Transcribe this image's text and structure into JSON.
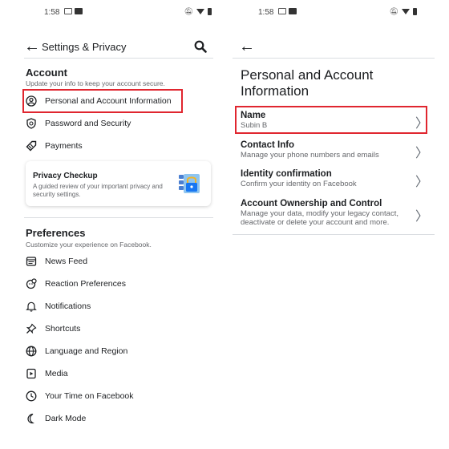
{
  "left": {
    "status_time": "1:58",
    "title": "Settings & Privacy",
    "account": {
      "title": "Account",
      "subtitle": "Update your info to keep your account secure.",
      "items": [
        {
          "label": "Personal and Account Information",
          "icon": "person-circle-icon"
        },
        {
          "label": "Password and Security",
          "icon": "shield-icon"
        },
        {
          "label": "Payments",
          "icon": "tag-icon"
        }
      ]
    },
    "privacy_checkup": {
      "title": "Privacy Checkup",
      "description": "A guided review of your important privacy and security settings.",
      "icon": "lock-checklist-icon"
    },
    "preferences": {
      "title": "Preferences",
      "subtitle": "Customize your experience on Facebook.",
      "items": [
        {
          "label": "News Feed",
          "icon": "news-feed-icon"
        },
        {
          "label": "Reaction Preferences",
          "icon": "reaction-icon"
        },
        {
          "label": "Notifications",
          "icon": "bell-icon"
        },
        {
          "label": "Shortcuts",
          "icon": "pin-icon"
        },
        {
          "label": "Language and Region",
          "icon": "globe-icon"
        },
        {
          "label": "Media",
          "icon": "media-icon"
        },
        {
          "label": "Your Time on Facebook",
          "icon": "clock-icon"
        },
        {
          "label": "Dark Mode",
          "icon": "moon-icon"
        }
      ]
    }
  },
  "right": {
    "status_time": "1:58",
    "heading": "Personal and Account Information",
    "rows": [
      {
        "title": "Name",
        "description": "Subin B"
      },
      {
        "title": "Contact Info",
        "description": "Manage your phone numbers and emails"
      },
      {
        "title": "Identity confirmation",
        "description": "Confirm your identity on Facebook"
      },
      {
        "title": "Account Ownership and Control",
        "description": "Manage your data, modify your legacy contact, deactivate or delete your account and more."
      }
    ]
  },
  "colors": {
    "highlight": "#e0262f",
    "text_primary": "#1c1e21",
    "text_secondary": "#65676b",
    "divider": "#dadde1"
  }
}
